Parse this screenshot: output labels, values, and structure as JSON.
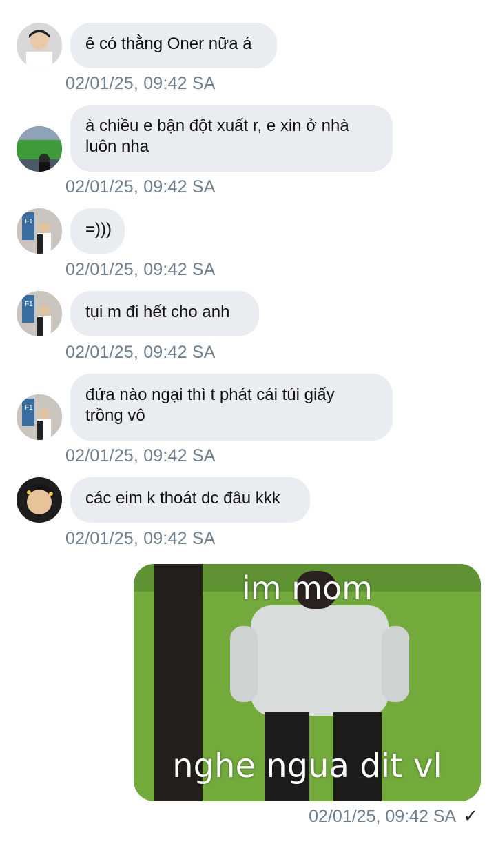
{
  "messages": [
    {
      "text": "ê có thằng Oner nữa á",
      "time": "02/01/25, 09:42 SA",
      "avatar": "avatar-peace-sign"
    },
    {
      "text": "à chiều e bận đột xuất r, e xin ở nhà\nluôn nha",
      "time": "02/01/25, 09:42 SA",
      "avatar": "avatar-stadium"
    },
    {
      "text": "=)))",
      "time": "02/01/25, 09:42 SA",
      "avatar": "avatar-f1-sign"
    },
    {
      "text": "tụi m đi hết cho anh",
      "time": "02/01/25, 09:42 SA",
      "avatar": "avatar-f1-sign"
    },
    {
      "text": "đứa nào ngại thì t phát cái túi giấy\ntrồng vô",
      "time": "02/01/25, 09:42 SA",
      "avatar": "avatar-f1-sign"
    },
    {
      "text": "các eim k thoát dc đâu kkk",
      "time": "02/01/25, 09:42 SA",
      "avatar": "avatar-face"
    }
  ],
  "outgoing": {
    "caption_top": "im mom",
    "caption_bottom": "nghe ngua dit vl",
    "time": "02/01/25, 09:42 SA",
    "status_icon": "✓"
  },
  "colors": {
    "bubble": "#e9edf1",
    "timestamp": "#6e7f8d",
    "grass": "#6ea83a"
  }
}
